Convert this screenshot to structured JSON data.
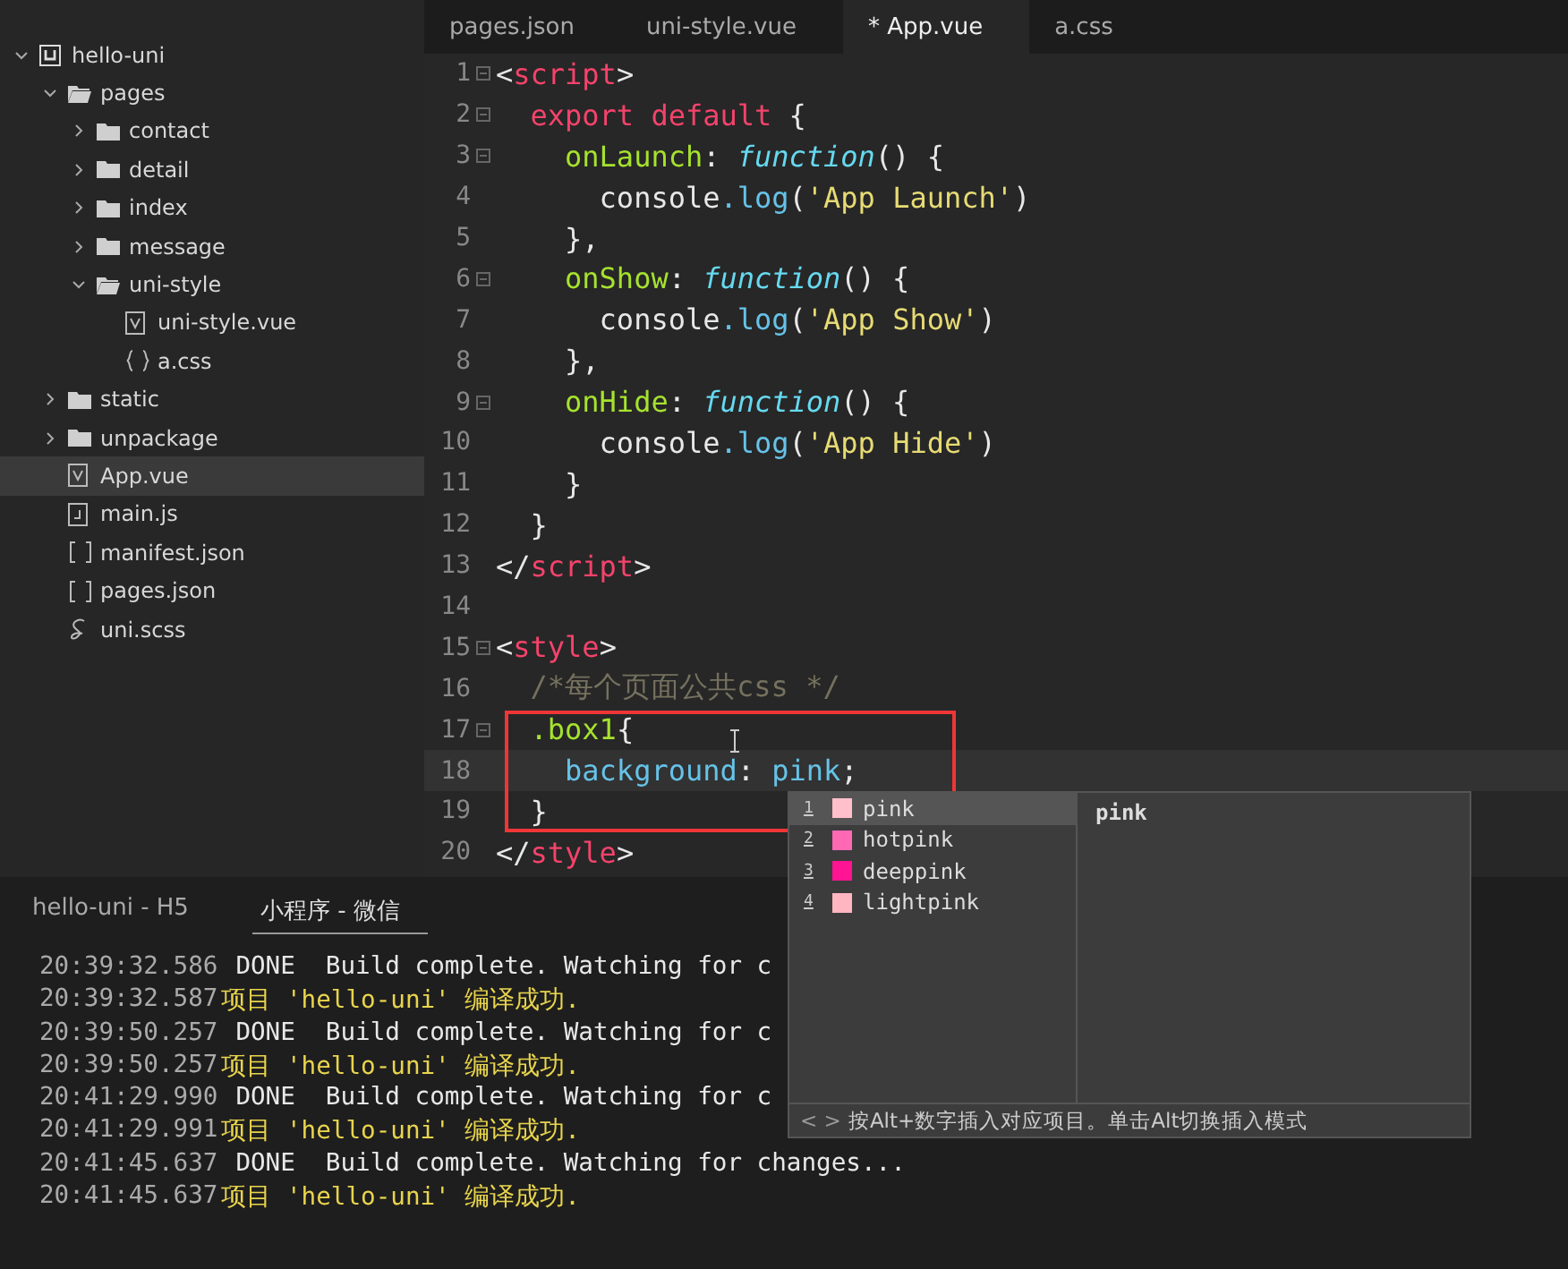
{
  "sidebar": {
    "tree": [
      {
        "label": "hello-uni",
        "kind": "project",
        "expanded": true,
        "selected": false,
        "children": [
          {
            "label": "pages",
            "kind": "folder",
            "expanded": true,
            "selected": false,
            "children": [
              {
                "label": "contact",
                "kind": "folder",
                "expanded": false,
                "selected": false
              },
              {
                "label": "detail",
                "kind": "folder",
                "expanded": false,
                "selected": false
              },
              {
                "label": "index",
                "kind": "folder",
                "expanded": false,
                "selected": false
              },
              {
                "label": "message",
                "kind": "folder",
                "expanded": false,
                "selected": false
              },
              {
                "label": "uni-style",
                "kind": "folder",
                "expanded": true,
                "selected": false,
                "children": [
                  {
                    "label": "uni-style.vue",
                    "kind": "vue",
                    "selected": false
                  },
                  {
                    "label": "a.css",
                    "kind": "css",
                    "selected": false
                  }
                ]
              }
            ]
          },
          {
            "label": "static",
            "kind": "folder",
            "expanded": false,
            "selected": false
          },
          {
            "label": "unpackage",
            "kind": "folder",
            "expanded": false,
            "selected": false
          },
          {
            "label": "App.vue",
            "kind": "vue",
            "selected": true
          },
          {
            "label": "main.js",
            "kind": "js",
            "selected": false
          },
          {
            "label": "manifest.json",
            "kind": "json",
            "selected": false
          },
          {
            "label": "pages.json",
            "kind": "json",
            "selected": false
          },
          {
            "label": "uni.scss",
            "kind": "scss",
            "selected": false
          }
        ]
      }
    ]
  },
  "tabs": [
    {
      "label": "pages.json",
      "selected": false
    },
    {
      "label": "uni-style.vue",
      "selected": false
    },
    {
      "label": "* App.vue",
      "selected": true
    },
    {
      "label": "a.css",
      "selected": false
    }
  ],
  "code": [
    {
      "number": "1",
      "fold": true,
      "current": false,
      "tokens": [
        {
          "kind": "punct",
          "text": "<"
        },
        {
          "kind": "tag",
          "text": "script"
        },
        {
          "kind": "punct",
          "text": ">"
        }
      ]
    },
    {
      "number": "2",
      "fold": true,
      "current": false,
      "tokens": [
        {
          "kind": "keyword",
          "text": "  export default"
        },
        {
          "kind": "punct",
          "text": " {"
        }
      ]
    },
    {
      "number": "3",
      "fold": true,
      "current": false,
      "tokens": [
        {
          "kind": "prop",
          "text": "    onLaunch"
        },
        {
          "kind": "punct",
          "text": ": "
        },
        {
          "kind": "fn",
          "text": "function"
        },
        {
          "kind": "punct",
          "text": "() {"
        }
      ]
    },
    {
      "number": "4",
      "fold": false,
      "current": false,
      "tokens": [
        {
          "kind": "punct",
          "text": "      console"
        },
        {
          "kind": "method",
          "text": ".log"
        },
        {
          "kind": "punct",
          "text": "("
        },
        {
          "kind": "string",
          "text": "'App Launch'"
        },
        {
          "kind": "punct",
          "text": ")"
        }
      ]
    },
    {
      "number": "5",
      "fold": false,
      "current": false,
      "tokens": [
        {
          "kind": "punct",
          "text": "    },"
        }
      ]
    },
    {
      "number": "6",
      "fold": true,
      "current": false,
      "tokens": [
        {
          "kind": "prop",
          "text": "    onShow"
        },
        {
          "kind": "punct",
          "text": ": "
        },
        {
          "kind": "fn",
          "text": "function"
        },
        {
          "kind": "punct",
          "text": "() {"
        }
      ]
    },
    {
      "number": "7",
      "fold": false,
      "current": false,
      "tokens": [
        {
          "kind": "punct",
          "text": "      console"
        },
        {
          "kind": "method",
          "text": ".log"
        },
        {
          "kind": "punct",
          "text": "("
        },
        {
          "kind": "string",
          "text": "'App Show'"
        },
        {
          "kind": "punct",
          "text": ")"
        }
      ]
    },
    {
      "number": "8",
      "fold": false,
      "current": false,
      "tokens": [
        {
          "kind": "punct",
          "text": "    },"
        }
      ]
    },
    {
      "number": "9",
      "fold": true,
      "current": false,
      "tokens": [
        {
          "kind": "prop",
          "text": "    onHide"
        },
        {
          "kind": "punct",
          "text": ": "
        },
        {
          "kind": "fn",
          "text": "function"
        },
        {
          "kind": "punct",
          "text": "() {"
        }
      ]
    },
    {
      "number": "10",
      "fold": false,
      "current": false,
      "tokens": [
        {
          "kind": "punct",
          "text": "      console"
        },
        {
          "kind": "method",
          "text": ".log"
        },
        {
          "kind": "punct",
          "text": "("
        },
        {
          "kind": "string",
          "text": "'App Hide'"
        },
        {
          "kind": "punct",
          "text": ")"
        }
      ]
    },
    {
      "number": "11",
      "fold": false,
      "current": false,
      "tokens": [
        {
          "kind": "punct",
          "text": "    }"
        }
      ]
    },
    {
      "number": "12",
      "fold": false,
      "current": false,
      "tokens": [
        {
          "kind": "punct",
          "text": "  }"
        }
      ]
    },
    {
      "number": "13",
      "fold": false,
      "current": false,
      "tokens": [
        {
          "kind": "punct",
          "text": "</"
        },
        {
          "kind": "tag",
          "text": "script"
        },
        {
          "kind": "punct",
          "text": ">"
        }
      ]
    },
    {
      "number": "14",
      "fold": false,
      "current": false
    },
    {
      "number": "15",
      "fold": true,
      "current": false,
      "tokens": [
        {
          "kind": "punct",
          "text": "<"
        },
        {
          "kind": "tag",
          "text": "style"
        },
        {
          "kind": "punct",
          "text": ">"
        }
      ]
    },
    {
      "number": "16",
      "fold": false,
      "current": false,
      "tokens": [
        {
          "kind": "comment",
          "text": "  /*每个页面公共css */"
        }
      ]
    },
    {
      "number": "17",
      "fold": true,
      "current": false,
      "tokens": [
        {
          "kind": "selector",
          "text": "  .box1"
        },
        {
          "kind": "punct",
          "text": "{"
        }
      ]
    },
    {
      "number": "18",
      "fold": false,
      "current": true,
      "tokens": [
        {
          "kind": "method",
          "text": "    background"
        },
        {
          "kind": "punct",
          "text": ": "
        },
        {
          "kind": "method",
          "text": "pink"
        },
        {
          "kind": "punct",
          "text": ";"
        }
      ]
    },
    {
      "number": "19",
      "fold": false,
      "current": false,
      "tokens": [
        {
          "kind": "punct",
          "text": "  }"
        }
      ]
    },
    {
      "number": "20",
      "fold": false,
      "current": false,
      "tokens": [
        {
          "kind": "punct",
          "text": "</"
        },
        {
          "kind": "tag",
          "text": "style"
        },
        {
          "kind": "punct",
          "text": ">"
        }
      ]
    }
  ],
  "autocomplete": {
    "items": [
      {
        "index": "1",
        "label": "pink",
        "color": "#ffc0cb",
        "selected": true
      },
      {
        "index": "2",
        "label": "hotpink",
        "color": "#ff69b4",
        "selected": false
      },
      {
        "index": "3",
        "label": "deeppink",
        "color": "#ff1493",
        "selected": false
      },
      {
        "index": "4",
        "label": "lightpink",
        "color": "#ffb6c1",
        "selected": false
      }
    ],
    "detail": "pink",
    "hint_arrows": "< >",
    "hint": "按Alt+数字插入对应项目。单击Alt切换插入模式"
  },
  "console": {
    "tabs": [
      {
        "label": "hello-uni - H5",
        "selected": false
      },
      {
        "label": "小程序 - 微信",
        "selected": true
      }
    ],
    "lines": [
      {
        "time": "20:39:32.586",
        "kind": "done",
        "tag": "DONE",
        "text": "Build complete. Watching for c"
      },
      {
        "time": "20:39:32.587",
        "kind": "success",
        "text": "项目 'hello-uni' 编译成功."
      },
      {
        "time": "20:39:50.257",
        "kind": "done",
        "tag": "DONE",
        "text": "Build complete. Watching for c"
      },
      {
        "time": "20:39:50.257",
        "kind": "success",
        "text": "项目 'hello-uni' 编译成功."
      },
      {
        "time": "20:41:29.990",
        "kind": "done",
        "tag": "DONE",
        "text": "Build complete. Watching for c"
      },
      {
        "time": "20:41:29.991",
        "kind": "success",
        "text": "项目 'hello-uni' 编译成功."
      },
      {
        "time": "20:41:45.637",
        "kind": "done",
        "tag": "DONE",
        "text": "Build complete. Watching for changes..."
      },
      {
        "time": "20:41:45.637",
        "kind": "success",
        "text": "项目 'hello-uni' 编译成功."
      }
    ]
  }
}
